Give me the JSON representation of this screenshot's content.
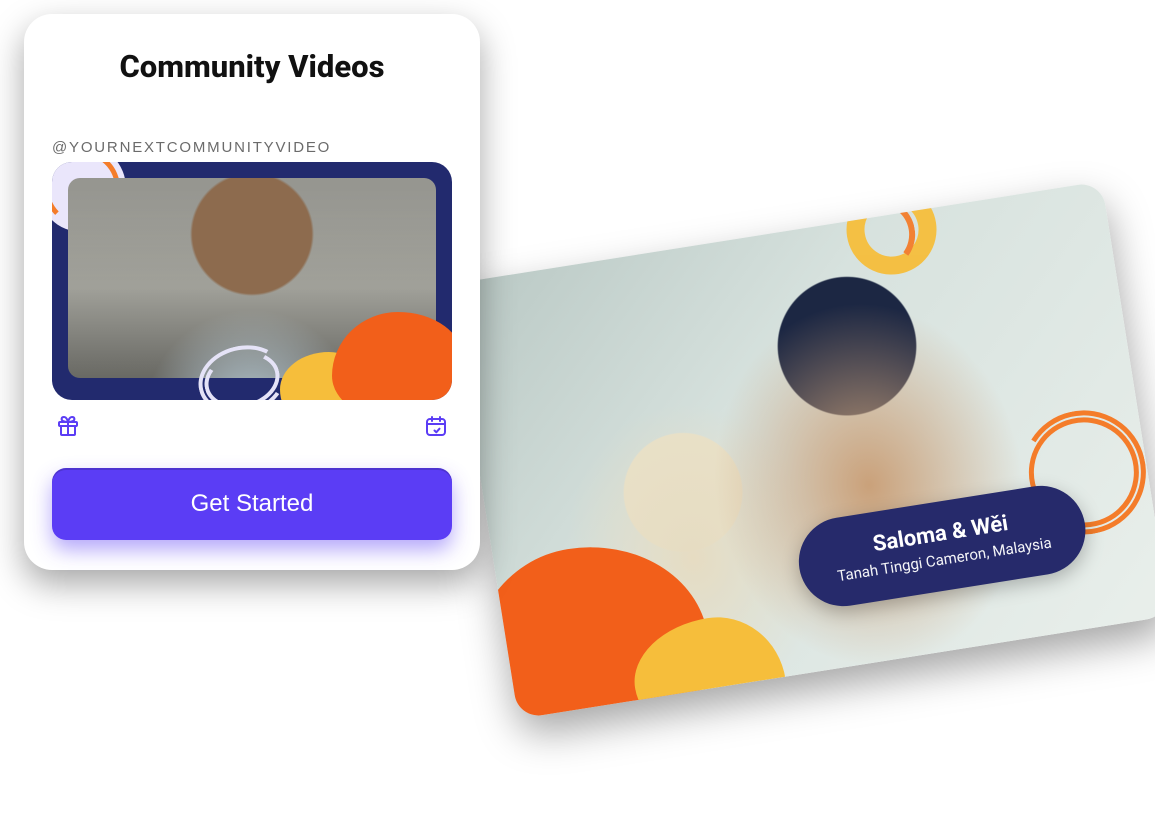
{
  "colors": {
    "accent": "#5b3df5",
    "orange": "#f25f1a",
    "yellow": "#f6be3b",
    "navy": "#262a6b"
  },
  "card": {
    "title": "Community Videos",
    "handle": "@YOURNEXTCOMMUNITYVIDEO",
    "cta_label": "Get Started",
    "icons": {
      "gift": "gift-icon",
      "calendar": "calendar-icon"
    }
  },
  "photo": {
    "names": "Saloma & Wěi",
    "location": "Tanah Tinggi Cameron, Malaysia"
  }
}
